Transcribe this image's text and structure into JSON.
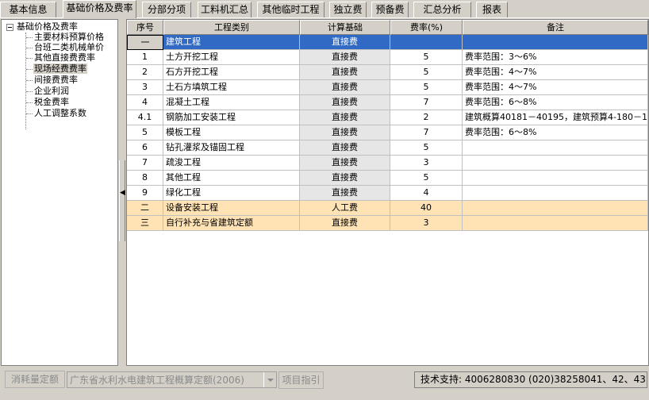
{
  "tabs": [
    {
      "label": "基本信息",
      "active": false
    },
    {
      "label": "基础价格及费率",
      "active": true
    },
    {
      "label": "分部分项",
      "active": false
    },
    {
      "label": "工料机汇总",
      "active": false
    },
    {
      "label": "其他临时工程",
      "active": false
    },
    {
      "label": "独立费",
      "active": false
    },
    {
      "label": "预备费",
      "active": false
    },
    {
      "label": "汇总分析",
      "active": false
    },
    {
      "label": "报表",
      "active": false
    }
  ],
  "tree": {
    "root": "基础价格及费率",
    "items": [
      "主要材料预算价格",
      "台班二类机械单价",
      "其他直接费费率",
      "现场经费费率",
      "间接费费率",
      "企业利润",
      "税金费率",
      "人工调整系数"
    ],
    "selected_index": 3
  },
  "grid": {
    "headers": [
      "序号",
      "工程类别",
      "计算基础",
      "费率(%)",
      "备注"
    ],
    "rows": [
      {
        "no": "一",
        "type": "建筑工程",
        "basis": "直接费",
        "rate": "",
        "note": "",
        "state": "sel"
      },
      {
        "no": "1",
        "type": "土方开挖工程",
        "basis": "直接费",
        "rate": "5",
        "note": "费率范围：3～6%",
        "state": ""
      },
      {
        "no": "2",
        "type": "石方开挖工程",
        "basis": "直接费",
        "rate": "5",
        "note": "费率范围：4～7%",
        "state": ""
      },
      {
        "no": "3",
        "type": "土石方填筑工程",
        "basis": "直接费",
        "rate": "5",
        "note": "费率范围：4～7%",
        "state": ""
      },
      {
        "no": "4",
        "type": "混凝土工程",
        "basis": "直接费",
        "rate": "7",
        "note": "费率范围：6～8%",
        "state": ""
      },
      {
        "no": "4.1",
        "type": "钢筋加工安装工程",
        "basis": "直接费",
        "rate": "2",
        "note": "建筑概算40181－40195，建筑预算4-180－1",
        "state": ""
      },
      {
        "no": "5",
        "type": "模板工程",
        "basis": "直接费",
        "rate": "7",
        "note": "费率范围：6～8%",
        "state": ""
      },
      {
        "no": "6",
        "type": "钻孔灌浆及锚固工程",
        "basis": "直接费",
        "rate": "5",
        "note": "",
        "state": ""
      },
      {
        "no": "7",
        "type": "疏浚工程",
        "basis": "直接费",
        "rate": "3",
        "note": "",
        "state": ""
      },
      {
        "no": "8",
        "type": "其他工程",
        "basis": "直接费",
        "rate": "5",
        "note": "",
        "state": ""
      },
      {
        "no": "9",
        "type": "绿化工程",
        "basis": "直接费",
        "rate": "4",
        "note": "",
        "state": ""
      },
      {
        "no": "二",
        "type": "设备安装工程",
        "basis": "人工费",
        "rate": "40",
        "note": "",
        "state": "hl"
      },
      {
        "no": "三",
        "type": "自行补充与省建筑定额",
        "basis": "直接费",
        "rate": "3",
        "note": "",
        "state": "hl"
      }
    ]
  },
  "bottom": {
    "consume_label": "消耗量定额",
    "quota_value": "广东省水利水电建筑工程概算定额(2006)",
    "guide_label": "项目指引",
    "support_text": "技术支持:  4006280830 (020)38258041、42、43"
  }
}
